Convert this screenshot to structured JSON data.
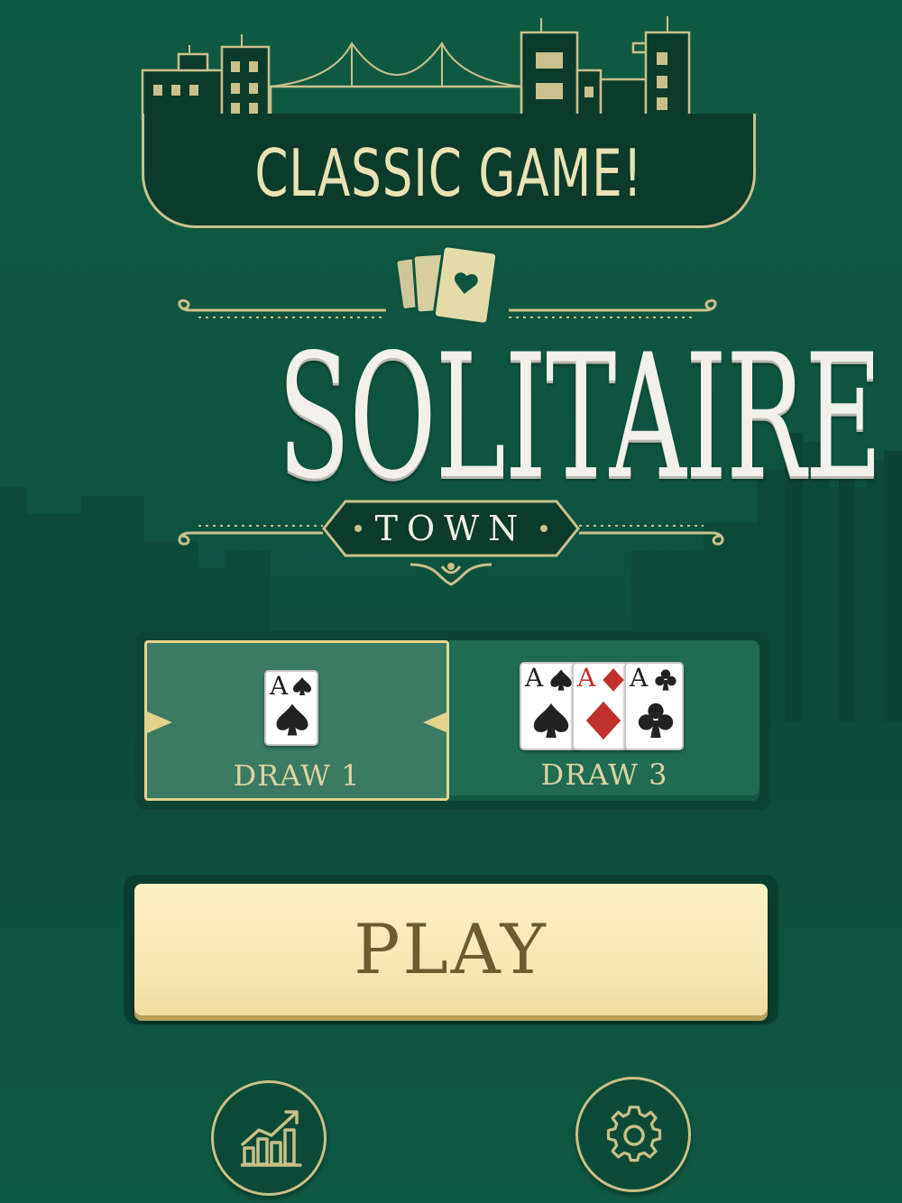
{
  "banner": {
    "text": "CLASSIC GAME!"
  },
  "logo": {
    "title": "SOLITAIRE",
    "subtitle": "TOWN"
  },
  "modes": [
    {
      "label": "DRAW 1",
      "selected": true,
      "cards": [
        {
          "rank": "A",
          "suit": "spade"
        }
      ]
    },
    {
      "label": "DRAW 3",
      "selected": false,
      "cards": [
        {
          "rank": "A",
          "suit": "spade"
        },
        {
          "rank": "A",
          "suit": "diamond"
        },
        {
          "rank": "A",
          "suit": "club"
        }
      ]
    }
  ],
  "play": {
    "label": "PLAY"
  },
  "footer": {
    "stats_icon": "bar-chart-trend-icon",
    "settings_icon": "gear-icon"
  },
  "colors": {
    "accent_gold": "#e3d38c",
    "background_green": "#0f5a42",
    "play_button": "#f6e8b2",
    "card_red": "#c0312c"
  }
}
